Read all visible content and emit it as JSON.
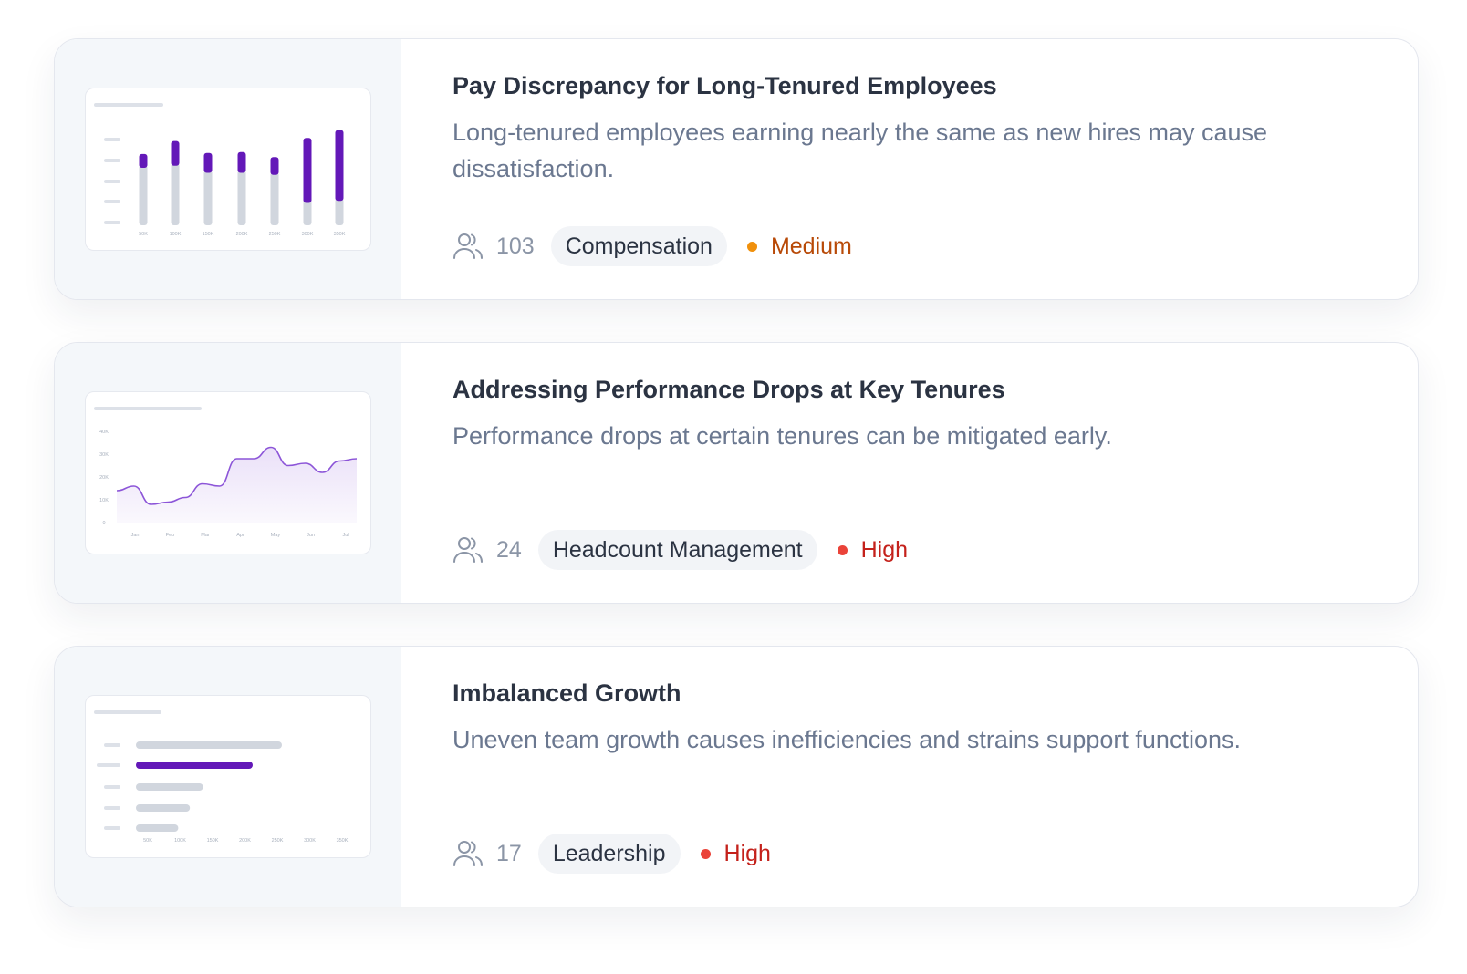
{
  "cards": [
    {
      "title": "Pay Discrepancy for Long-Tenured Employees",
      "description": "Long-tenured employees earning nearly the same as new hires may cause dissatisfaction.",
      "count": "103",
      "tag": "Compensation",
      "severity": "Medium",
      "severity_color": "#b84a08",
      "severity_dot": "#f0900c",
      "icon": "people-icon",
      "thumbnail": {
        "type": "stacked-bar",
        "x_labels": [
          "50K",
          "100K",
          "150K",
          "200K",
          "250K",
          "300K",
          "350K"
        ],
        "accent": "#6318b8",
        "base": "#d1d6de",
        "series": [
          {
            "values": [
              0.6,
              0.62,
              0.55,
              0.55,
              0.53,
              0.25,
              0.27
            ]
          },
          {
            "values": [
              0.11,
              0.22,
              0.17,
              0.18,
              0.15,
              0.62,
              0.68
            ]
          }
        ]
      }
    },
    {
      "title": "Addressing Performance Drops at Key Tenures",
      "description": "Performance drops at certain tenures can be mitigated early.",
      "count": "24",
      "tag": "Headcount Management",
      "severity": "High",
      "severity_color": "#c4211b",
      "severity_dot": "#ea4339",
      "icon": "people-icon",
      "thumbnail": {
        "type": "area",
        "y_labels": [
          "40K",
          "30K",
          "20K",
          "10K",
          "0"
        ],
        "x_labels": [
          "Jan",
          "Feb",
          "Mar",
          "Apr",
          "May",
          "Jun",
          "Jul"
        ],
        "accent": "#8c55d8",
        "values": [
          14,
          16,
          8,
          9,
          11,
          17,
          16,
          28,
          28,
          33,
          25,
          26,
          22,
          27,
          28
        ]
      }
    },
    {
      "title": "Imbalanced Growth",
      "description": "Uneven team growth causes inefficiencies and strains support functions.",
      "count": "17",
      "tag": "Leadership",
      "severity": "High",
      "severity_color": "#c4211b",
      "severity_dot": "#ea4339",
      "icon": "people-icon",
      "thumbnail": {
        "type": "horizontal-bar",
        "x_labels": [
          "50K",
          "100K",
          "150K",
          "200K",
          "250K",
          "300K",
          "350K"
        ],
        "accent": "#6318b8",
        "base": "#d1d6de",
        "values": [
          1.0,
          0.8,
          0.46,
          0.37,
          0.29
        ],
        "highlight_index": 1
      }
    }
  ]
}
